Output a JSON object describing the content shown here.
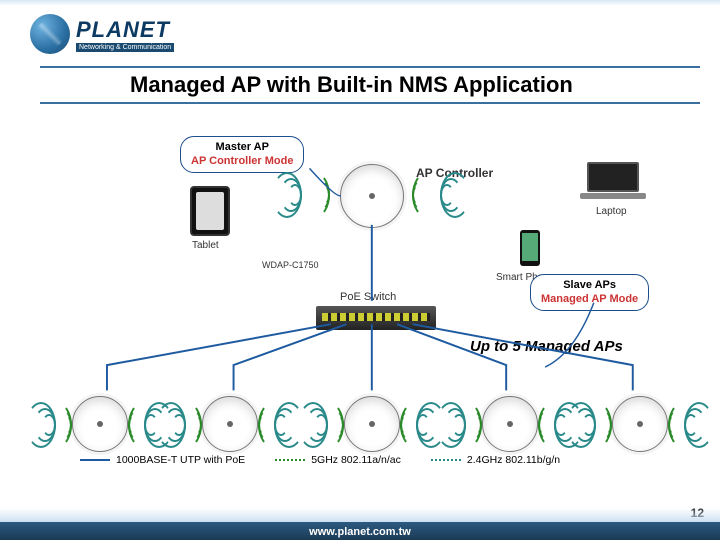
{
  "brand": {
    "name": "PLANET",
    "tagline": "Networking & Communication"
  },
  "title": "Managed AP with Built-in NMS Application",
  "master_label": {
    "line1": "Master AP",
    "line2": "AP Controller Mode"
  },
  "slave_label": {
    "line1": "Slave APs",
    "line2": "Managed AP Mode"
  },
  "devices": {
    "controller": "AP Controller",
    "tablet": "Tablet",
    "laptop": "Laptop",
    "phone": "Smart Phone",
    "switch": "PoE Switch",
    "model": "WDAP-C1750"
  },
  "caption": "Up to 5 Managed APs",
  "legend": {
    "cable": "1000BASE-T UTP with PoE",
    "band5": "5GHz 802.11a/n/ac",
    "band24": "2.4GHz 802.11b/g/n"
  },
  "footer_url": "www.planet.com.tw",
  "page_number": "12",
  "colors": {
    "accent": "#1b4e8a",
    "red": "#c33",
    "green": "#2a8a2a",
    "teal": "#2a8a8a"
  }
}
